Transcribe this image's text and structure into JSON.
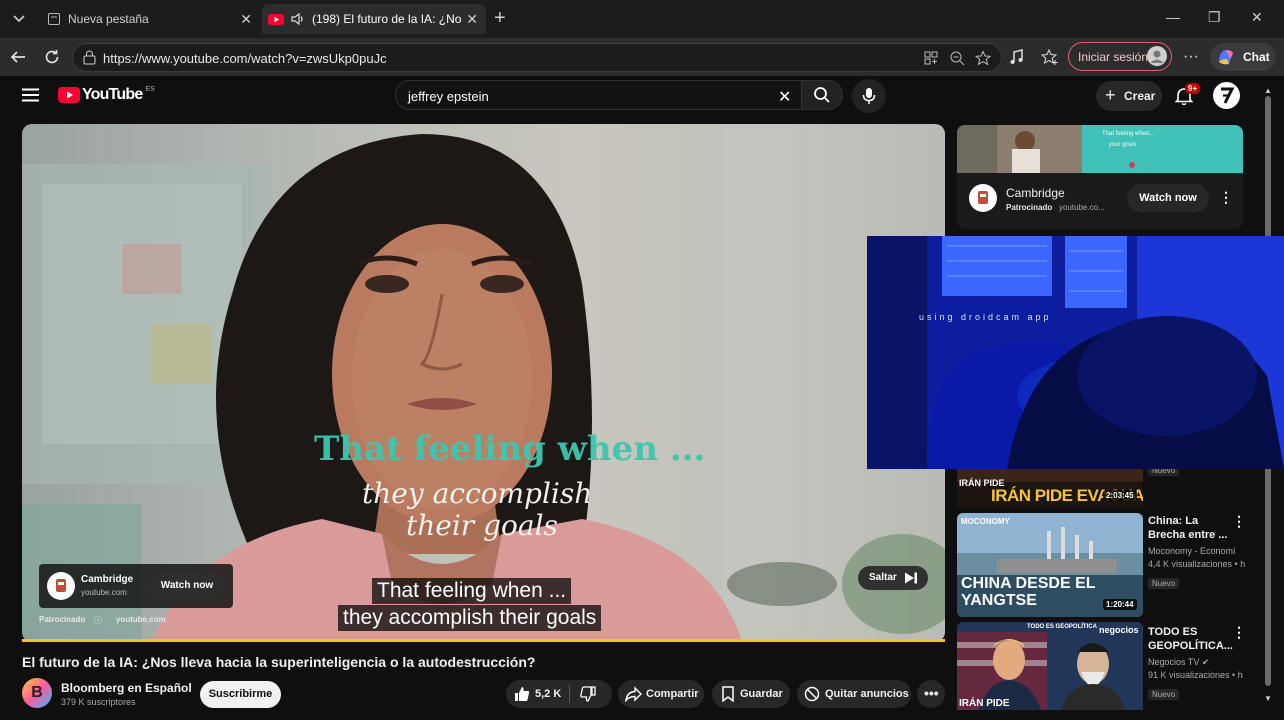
{
  "browser": {
    "tabs": [
      {
        "title": "Nueva pestaña",
        "active": false
      },
      {
        "title": "(198) El futuro de la IA: ¿Nos l",
        "active": true
      }
    ],
    "url": "https://www.youtube.com/watch?v=zwsUkp0puJc",
    "signin_label": "Iniciar sesión",
    "chat_label": "Chat"
  },
  "youtube": {
    "logo_text": "YouTube",
    "region": "ES",
    "search_value": "jeffrey epstein",
    "create_label": "Crear",
    "notification_count": "9+",
    "accent": "#ff0033"
  },
  "video": {
    "overlay_line1": "That feeling when ...",
    "overlay_line2": "they accomplish",
    "overlay_line3": "their goals",
    "caption_line1": "That feeling when ...",
    "caption_line2": "they accomplish their goals",
    "ad": {
      "brand": "Cambridge",
      "domain": "youtube.com",
      "cta": "Watch now",
      "sponsored": "Patrocinado",
      "sponsored_domain": "youtube.com",
      "skip": "Saltar"
    },
    "progress_color": "#f0c419",
    "title": "El futuro de la IA: ¿Nos lleva hacia la superinteligencia o la autodestrucción?",
    "channel": {
      "name": "Bloomberg en Español",
      "initial": "B",
      "subscribers": "379 K suscriptores",
      "subscribe_label": "Suscribirme"
    },
    "actions": {
      "likes": "5,2 K",
      "share": "Compartir",
      "save": "Guardar",
      "remove_ads": "Quitar anuncios"
    }
  },
  "sidebar": {
    "ad": {
      "banner_line1": "That feeling when...",
      "banner_line2": "your goals",
      "brand": "Cambridge",
      "sponsored": "Patrocinado",
      "domain": "youtube.co...",
      "cta": "Watch now"
    },
    "overlay_text": "using droidcam app",
    "items": [
      {
        "thumb_text": "IRÁN PIDE EVACUACIÓN",
        "thumb_small": "IRÁN PIDE",
        "duration": "2:03:45",
        "badge": "Nuevo"
      },
      {
        "thumb_text": "CHINA DESDE EL YANGTSE",
        "thumb_top": "MOCONOMY",
        "duration": "1:20:44",
        "title": "China: La Brecha entre ...",
        "channel": "Moconomy - Economí...",
        "views": "4,4 K visualizaciones • h",
        "badge": "Nuevo"
      },
      {
        "thumb_text": "IRÁN PIDE",
        "thumb_top": "TODO ES GEOPOLÍTICA",
        "thumb_tag": "negocios",
        "title": "TODO ES GEOPOLÍTICA...",
        "channel": "Negocios TV",
        "views": "91 K visualizaciones • h",
        "badge": "Nuevo"
      }
    ]
  }
}
